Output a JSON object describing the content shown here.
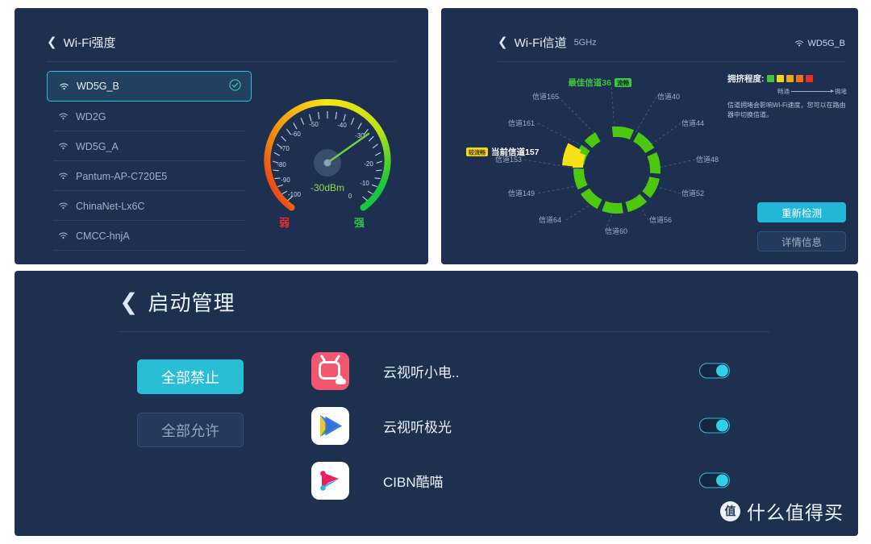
{
  "panel_strength": {
    "title": "Wi-Fi强度",
    "back_icon": "chevron-left-icon",
    "networks": [
      {
        "name": "WD5G_B",
        "selected": true,
        "icon": "wifi-icon",
        "check_icon": "check-circle-icon"
      },
      {
        "name": "WD2G",
        "selected": false,
        "icon": "wifi-icon"
      },
      {
        "name": "WD5G_A",
        "selected": false,
        "icon": "wifi-icon"
      },
      {
        "name": "Pantum-AP-C720E5",
        "selected": false,
        "icon": "wifi-icon"
      },
      {
        "name": "ChinaNet-Lx6C",
        "selected": false,
        "icon": "wifi-icon"
      },
      {
        "name": "CMCC-hnjA",
        "selected": false,
        "icon": "wifi-icon"
      }
    ],
    "gauge": {
      "value_label": "-30dBm",
      "value": -30,
      "min": -100,
      "max": 0,
      "ticks": [
        "-100",
        "-90",
        "-80",
        "-70",
        "-60",
        "-50",
        "-40",
        "-30",
        "-20",
        "-10",
        "0"
      ],
      "weak_label": "弱",
      "strong_label": "强",
      "weak_color": "#e2322a",
      "strong_color": "#2ec44c"
    }
  },
  "panel_channel": {
    "title": "Wi-Fi信道",
    "band": "5GHz",
    "ssid": "WD5G_B",
    "ssid_icon": "wifi-icon",
    "best_channel_label": "最佳信道36",
    "best_channel_badge": "流畅",
    "current_channel_label": "当前信道157",
    "current_channel_badge": "较流畅",
    "channel_labels": [
      "信道165",
      "信道161",
      "信道153",
      "信道149",
      "信道64",
      "信道60",
      "信道56",
      "信道52",
      "信道48",
      "信道44",
      "信道40"
    ],
    "legend": {
      "title": "拥挤程度:",
      "swatches": [
        "#3fc53f",
        "#f2d716",
        "#f0a417",
        "#f0731a",
        "#ec2d24"
      ],
      "scale_left": "畅通",
      "scale_right": "拥堵",
      "description": "信道拥堵会影响Wi-Fi速度，您可以在路由器中切换信道。"
    },
    "buttons": {
      "rescan": "重新检测",
      "detail": "详情信息"
    }
  },
  "panel_startup": {
    "title": "启动管理",
    "back_icon": "chevron-left-icon",
    "deny_all": "全部禁止",
    "allow_all": "全部允许",
    "apps": [
      {
        "name": "云视听小电..",
        "icon": "tv-app-icon",
        "enabled": true
      },
      {
        "name": "云视听极光",
        "icon": "play-app-icon",
        "enabled": true
      },
      {
        "name": "CIBN酷喵",
        "icon": "cibn-app-icon",
        "enabled": true
      }
    ]
  },
  "watermark": {
    "badge": "值",
    "text": "什么值得买"
  },
  "colors": {
    "panel_bg": "#1e3050",
    "accent": "#29bdd6",
    "ring_green": "#4cc90f",
    "ring_yellow": "#f7e017"
  }
}
